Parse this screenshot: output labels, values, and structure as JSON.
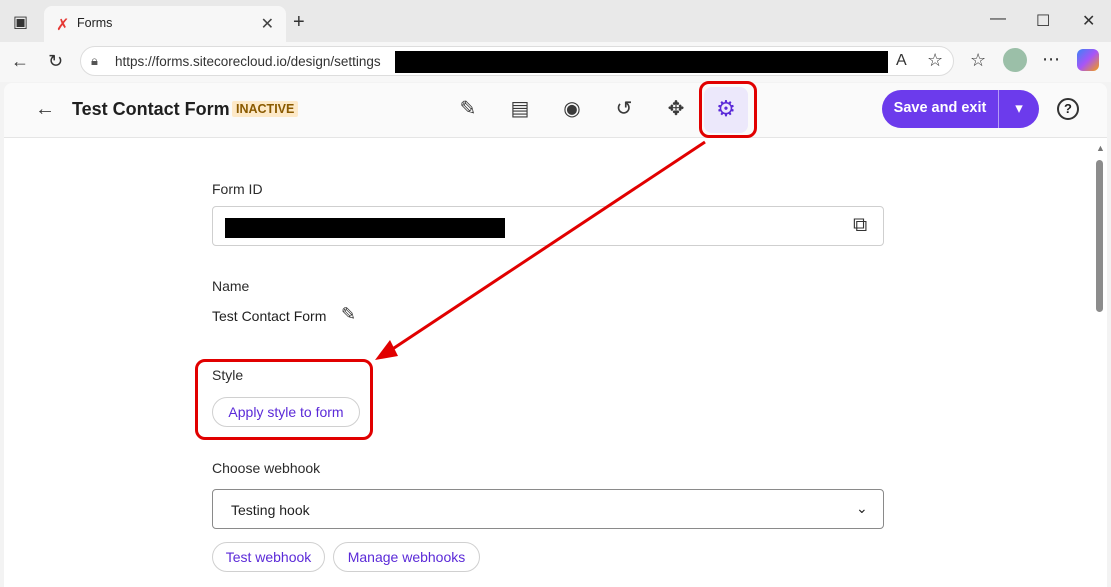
{
  "browser": {
    "tab_title": "Forms",
    "url": "https://forms.sitecorecloud.io/design/settings",
    "icons": {
      "sidebar": "sidebar-toggle-icon",
      "favicon": "sitecore-favicon",
      "close": "close-icon",
      "new_tab": "plus-icon",
      "back": "back-arrow-icon",
      "refresh": "refresh-icon",
      "lock": "lock-icon",
      "read_aloud": "read-aloud-icon",
      "favorite": "star-icon",
      "favorites": "favorites-icon",
      "more": "more-icon",
      "copilot": "copilot-icon"
    }
  },
  "header": {
    "title": "Test Contact Form",
    "status_badge": "INACTIVE",
    "save_label": "Save and exit"
  },
  "form": {
    "form_id_label": "Form ID",
    "name_label": "Name",
    "name_value": "Test Contact Form",
    "style_label": "Style",
    "apply_style_label": "Apply style to form",
    "webhook_label": "Choose webhook",
    "webhook_value": "Testing hook",
    "test_webhook_label": "Test webhook",
    "manage_webhooks_label": "Manage webhooks"
  },
  "colors": {
    "accent": "#6c3bec",
    "annotation_red": "#e10000",
    "badge_bg": "#fde9c8",
    "badge_text": "#8a5a00"
  }
}
